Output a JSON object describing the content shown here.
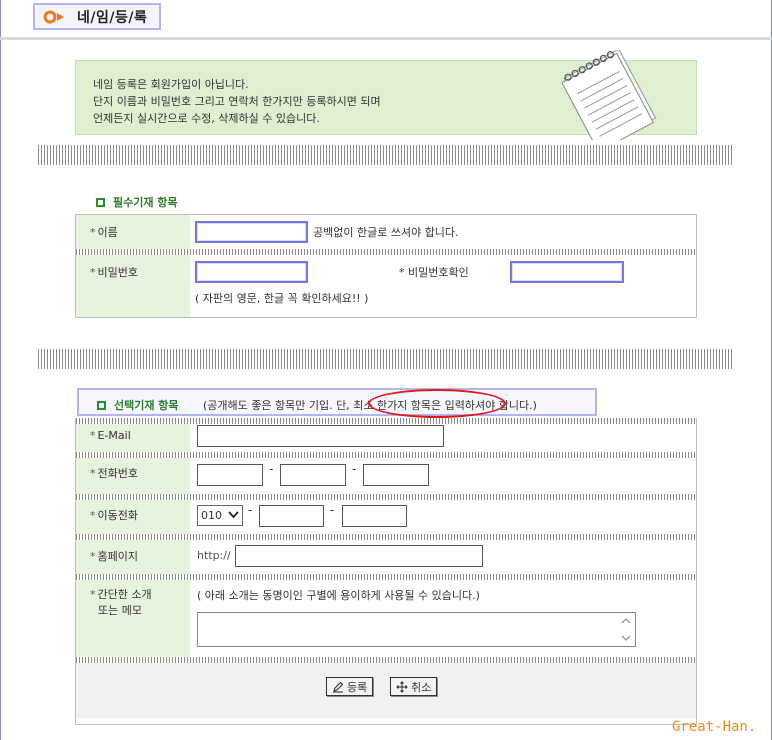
{
  "page": {
    "title": "네/임/등/록"
  },
  "notice": {
    "lines": [
      "네임 등록은 회원가입이 아닙니다.",
      "단지 이름과 비밀번호 그리고 연락처 한가지만 등록하시면 되며",
      "언제든지 실시간으로 수정, 삭제하실 수 있습니다."
    ]
  },
  "required": {
    "title": "필수기재 항목",
    "name_label": "이름",
    "name_hint": "공백없이 한글로 쓰셔야 합니다.",
    "password_label": "비밀번호",
    "password_confirm_label": "비밀번호확인",
    "password_hint": "( 자판의 영문, 한글 꼭 확인하세요!! )"
  },
  "optional": {
    "title": "선택기재 항목",
    "note": "(공개해도 좋은 항목만 기입.  단, 최소 한가지 항목은 입력하셔야 합니다.)",
    "email_label": "E-Mail",
    "phone_label": "전화번호",
    "mobile_label": "이동전화",
    "mobile_prefix": "010",
    "homepage_label": "홈페이지",
    "homepage_prefix": "http://",
    "memo_label_1": "간단한 소개",
    "memo_label_2": "또는 메모",
    "memo_hint": "( 아래 소개는 동명이인 구별에 용이하게 사용될 수 있습니다.)",
    "dash": "-"
  },
  "buttons": {
    "register": "등록",
    "cancel": "취소"
  },
  "watermark": "Great-Han.",
  "colors": {
    "accent_green": "#2e7d2e",
    "label_bg": "#e8f3dd",
    "notice_bg": "#dff0d1",
    "highlight_red": "#e01818",
    "box_border": "#b4b4ee",
    "watermark": "#f08a1c"
  }
}
